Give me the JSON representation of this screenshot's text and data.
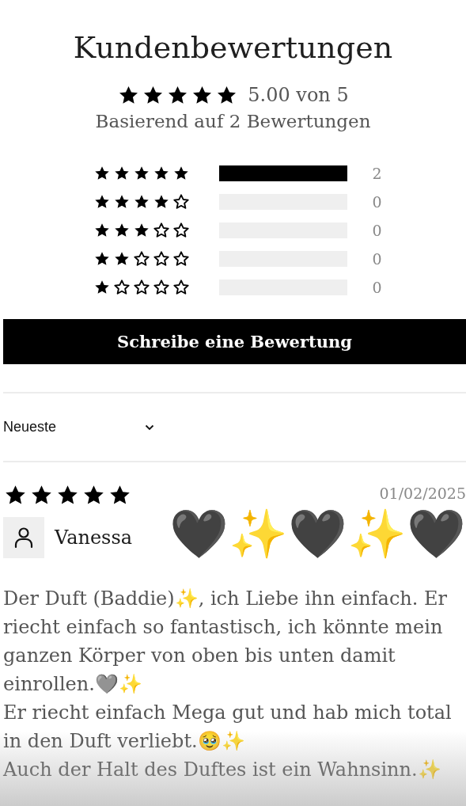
{
  "title": "Kundenbewertungen",
  "summary": {
    "stars": 5,
    "average": "5.00 von 5",
    "based_on": "Basierend auf 2 Bewertungen"
  },
  "histogram": [
    {
      "stars": 5,
      "level": 1,
      "count": "2"
    },
    {
      "stars": 4,
      "level": 0,
      "count": "0"
    },
    {
      "stars": 3,
      "level": 0,
      "count": "0"
    },
    {
      "stars": 2,
      "level": 0,
      "count": "0"
    },
    {
      "stars": 1,
      "level": 0,
      "count": "0"
    }
  ],
  "write_button": "Schreibe eine Bewertung",
  "sort": {
    "value": "Neueste"
  },
  "reviews": [
    {
      "stars": 5,
      "date": "01/02/2025",
      "author": "Vanessa",
      "title": "🖤✨🖤✨🖤",
      "body": [
        "Der Duft (Baddie)✨, ich Liebe ihn einfach. Er riecht einfach so fantastisch, ich könnte mein ganzen Körper von oben bis unten damit einrollen.🩶✨",
        "Er riecht einfach Mega gut und hab mich total in den Duft verliebt.🥹✨",
        "Auch der Halt des Duftes ist ein Wahnsinn.✨"
      ]
    }
  ]
}
